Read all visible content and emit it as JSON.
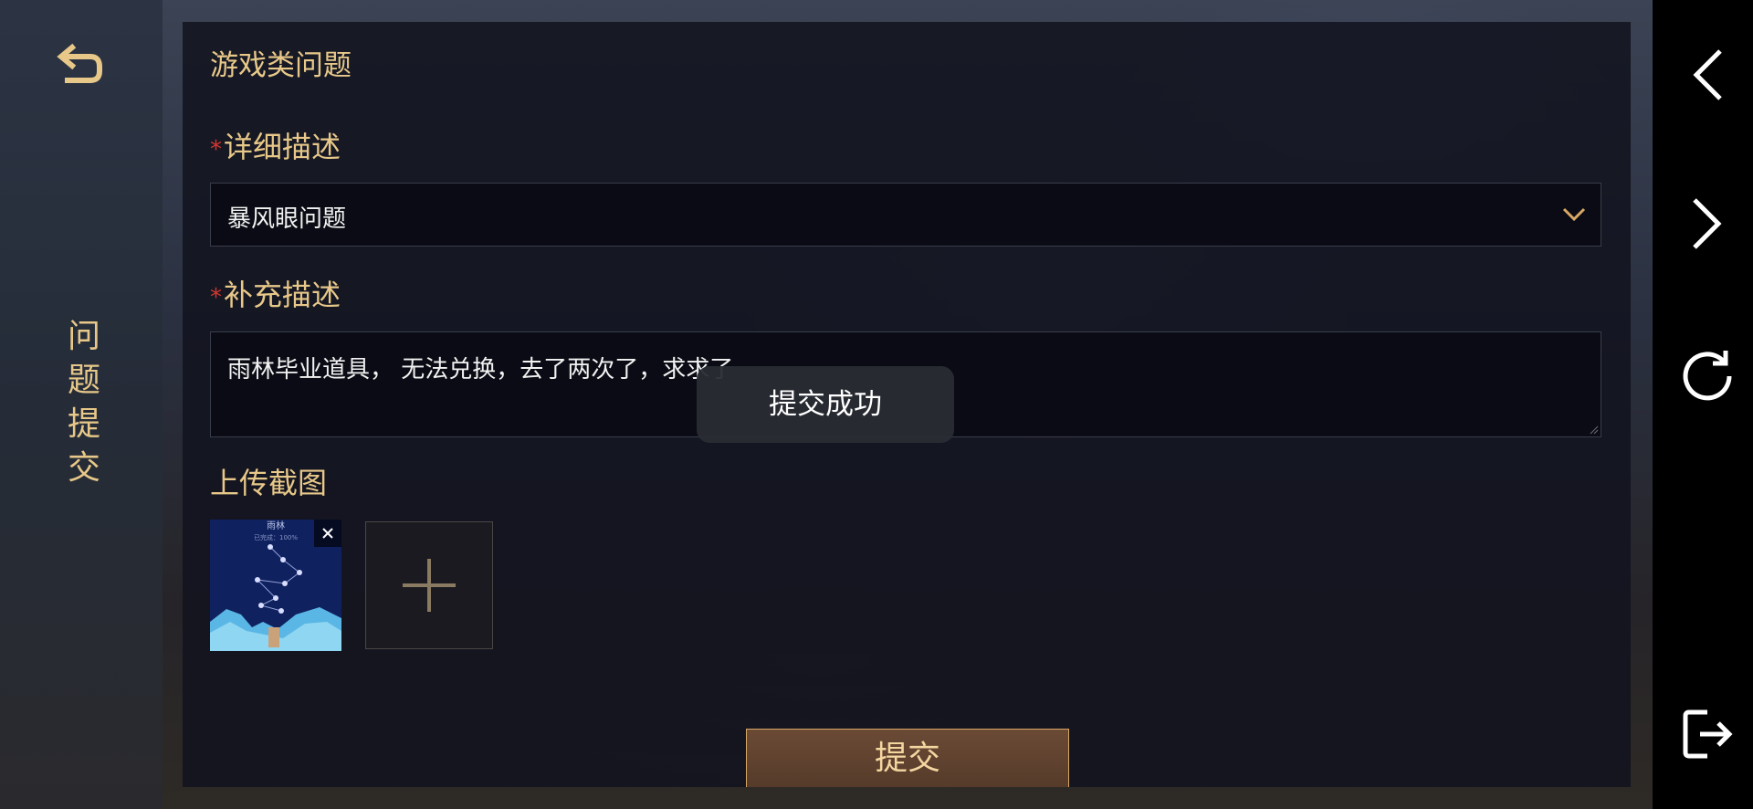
{
  "side": {
    "title_chars": [
      "问",
      "题",
      "提",
      "交"
    ]
  },
  "form": {
    "category_title": "游戏类问题",
    "required_mark": "*",
    "detail_label": "详细描述",
    "detail_value": "暴风眼问题",
    "extra_label": "补充描述",
    "extra_value": "雨林毕业道具，  无法兑换，去了两次了，求求了",
    "upload_label": "上传截图",
    "submit_label": "提交"
  },
  "thumbnail": {
    "caption_title": "雨林",
    "caption_sub": "已完成：100%"
  },
  "toast": {
    "message": "提交成功"
  },
  "colors": {
    "accent_gold": "#e8c889",
    "required_red": "#d2372f",
    "button_brown": "#5f4230"
  },
  "icons": {
    "back": "return-arrow-icon",
    "chevron": "chevron-down-icon",
    "close": "close-icon",
    "add": "plus-icon",
    "nav_back": "chevron-left-icon",
    "nav_forward": "chevron-right-icon",
    "nav_refresh": "refresh-icon",
    "nav_exit": "exit-icon"
  }
}
